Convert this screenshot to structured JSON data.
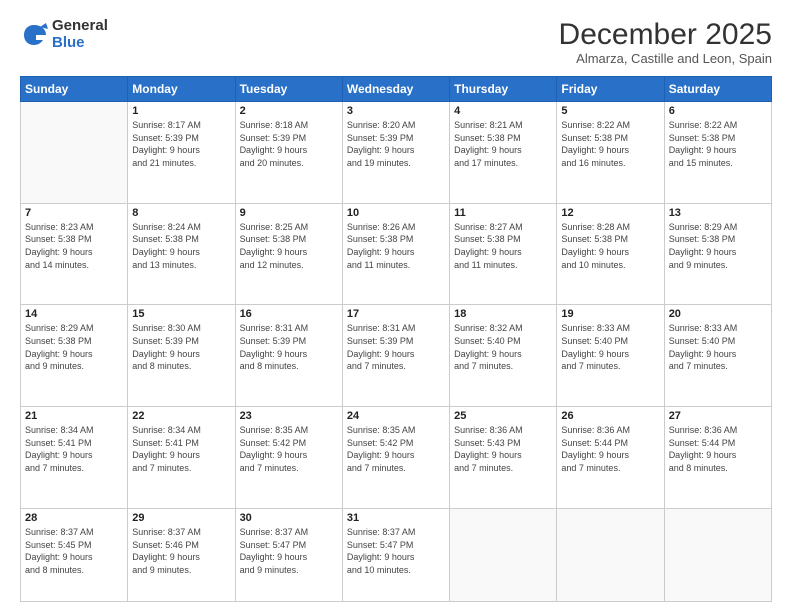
{
  "logo": {
    "general": "General",
    "blue": "Blue"
  },
  "header": {
    "title": "December 2025",
    "subtitle": "Almarza, Castille and Leon, Spain"
  },
  "weekdays": [
    "Sunday",
    "Monday",
    "Tuesday",
    "Wednesday",
    "Thursday",
    "Friday",
    "Saturday"
  ],
  "weeks": [
    [
      {
        "day": "",
        "info": ""
      },
      {
        "day": "1",
        "info": "Sunrise: 8:17 AM\nSunset: 5:39 PM\nDaylight: 9 hours\nand 21 minutes."
      },
      {
        "day": "2",
        "info": "Sunrise: 8:18 AM\nSunset: 5:39 PM\nDaylight: 9 hours\nand 20 minutes."
      },
      {
        "day": "3",
        "info": "Sunrise: 8:20 AM\nSunset: 5:39 PM\nDaylight: 9 hours\nand 19 minutes."
      },
      {
        "day": "4",
        "info": "Sunrise: 8:21 AM\nSunset: 5:38 PM\nDaylight: 9 hours\nand 17 minutes."
      },
      {
        "day": "5",
        "info": "Sunrise: 8:22 AM\nSunset: 5:38 PM\nDaylight: 9 hours\nand 16 minutes."
      },
      {
        "day": "6",
        "info": "Sunrise: 8:22 AM\nSunset: 5:38 PM\nDaylight: 9 hours\nand 15 minutes."
      }
    ],
    [
      {
        "day": "7",
        "info": "Sunrise: 8:23 AM\nSunset: 5:38 PM\nDaylight: 9 hours\nand 14 minutes."
      },
      {
        "day": "8",
        "info": "Sunrise: 8:24 AM\nSunset: 5:38 PM\nDaylight: 9 hours\nand 13 minutes."
      },
      {
        "day": "9",
        "info": "Sunrise: 8:25 AM\nSunset: 5:38 PM\nDaylight: 9 hours\nand 12 minutes."
      },
      {
        "day": "10",
        "info": "Sunrise: 8:26 AM\nSunset: 5:38 PM\nDaylight: 9 hours\nand 11 minutes."
      },
      {
        "day": "11",
        "info": "Sunrise: 8:27 AM\nSunset: 5:38 PM\nDaylight: 9 hours\nand 11 minutes."
      },
      {
        "day": "12",
        "info": "Sunrise: 8:28 AM\nSunset: 5:38 PM\nDaylight: 9 hours\nand 10 minutes."
      },
      {
        "day": "13",
        "info": "Sunrise: 8:29 AM\nSunset: 5:38 PM\nDaylight: 9 hours\nand 9 minutes."
      }
    ],
    [
      {
        "day": "14",
        "info": "Sunrise: 8:29 AM\nSunset: 5:38 PM\nDaylight: 9 hours\nand 9 minutes."
      },
      {
        "day": "15",
        "info": "Sunrise: 8:30 AM\nSunset: 5:39 PM\nDaylight: 9 hours\nand 8 minutes."
      },
      {
        "day": "16",
        "info": "Sunrise: 8:31 AM\nSunset: 5:39 PM\nDaylight: 9 hours\nand 8 minutes."
      },
      {
        "day": "17",
        "info": "Sunrise: 8:31 AM\nSunset: 5:39 PM\nDaylight: 9 hours\nand 7 minutes."
      },
      {
        "day": "18",
        "info": "Sunrise: 8:32 AM\nSunset: 5:40 PM\nDaylight: 9 hours\nand 7 minutes."
      },
      {
        "day": "19",
        "info": "Sunrise: 8:33 AM\nSunset: 5:40 PM\nDaylight: 9 hours\nand 7 minutes."
      },
      {
        "day": "20",
        "info": "Sunrise: 8:33 AM\nSunset: 5:40 PM\nDaylight: 9 hours\nand 7 minutes."
      }
    ],
    [
      {
        "day": "21",
        "info": "Sunrise: 8:34 AM\nSunset: 5:41 PM\nDaylight: 9 hours\nand 7 minutes."
      },
      {
        "day": "22",
        "info": "Sunrise: 8:34 AM\nSunset: 5:41 PM\nDaylight: 9 hours\nand 7 minutes."
      },
      {
        "day": "23",
        "info": "Sunrise: 8:35 AM\nSunset: 5:42 PM\nDaylight: 9 hours\nand 7 minutes."
      },
      {
        "day": "24",
        "info": "Sunrise: 8:35 AM\nSunset: 5:42 PM\nDaylight: 9 hours\nand 7 minutes."
      },
      {
        "day": "25",
        "info": "Sunrise: 8:36 AM\nSunset: 5:43 PM\nDaylight: 9 hours\nand 7 minutes."
      },
      {
        "day": "26",
        "info": "Sunrise: 8:36 AM\nSunset: 5:44 PM\nDaylight: 9 hours\nand 7 minutes."
      },
      {
        "day": "27",
        "info": "Sunrise: 8:36 AM\nSunset: 5:44 PM\nDaylight: 9 hours\nand 8 minutes."
      }
    ],
    [
      {
        "day": "28",
        "info": "Sunrise: 8:37 AM\nSunset: 5:45 PM\nDaylight: 9 hours\nand 8 minutes."
      },
      {
        "day": "29",
        "info": "Sunrise: 8:37 AM\nSunset: 5:46 PM\nDaylight: 9 hours\nand 9 minutes."
      },
      {
        "day": "30",
        "info": "Sunrise: 8:37 AM\nSunset: 5:47 PM\nDaylight: 9 hours\nand 9 minutes."
      },
      {
        "day": "31",
        "info": "Sunrise: 8:37 AM\nSunset: 5:47 PM\nDaylight: 9 hours\nand 10 minutes."
      },
      {
        "day": "",
        "info": ""
      },
      {
        "day": "",
        "info": ""
      },
      {
        "day": "",
        "info": ""
      }
    ]
  ]
}
